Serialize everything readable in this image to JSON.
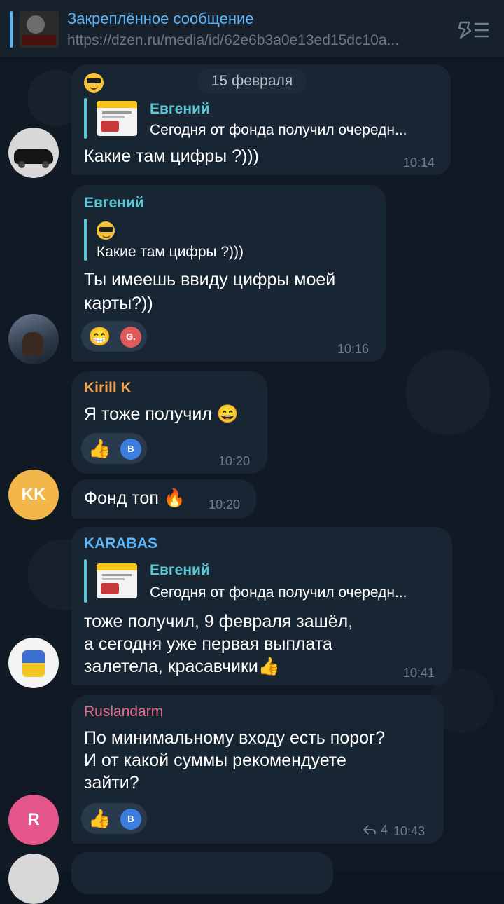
{
  "pinned": {
    "title": "Закреплённое сообщение",
    "url": "https://dzen.ru/media/id/62e6b3a0e13ed15dc10a..."
  },
  "date_divider": "15 февраля",
  "messages": [
    {
      "reply_name": "Евгений",
      "reply_text": "Сегодня от фонда получил очередн...",
      "text": "Какие там цифры ?)))",
      "time": "10:14"
    },
    {
      "sender": "Евгений",
      "reply_text": "Какие там цифры ?)))",
      "text_line1": "Ты имеешь ввиду цифры моей",
      "text_line2": "карты?))",
      "reaction_emoji": "😁",
      "reaction_user": "G.",
      "time": "10:16"
    },
    {
      "sender": "Kirill K",
      "text": "Я тоже получил 😄",
      "reaction_emoji": "👍",
      "reaction_user": "B",
      "time": "10:20"
    },
    {
      "text": "Фонд топ 🔥",
      "time": "10:20",
      "avatar_initials": "KK"
    },
    {
      "sender": "KARABAS",
      "reply_name": "Евгений",
      "reply_text": "Сегодня от фонда получил очередн...",
      "text_line1": "тоже получил, 9 февраля зашёл,",
      "text_line2": "а сегодня уже первая выплата",
      "text_line3": "залетела, красавчики👍",
      "time": "10:41"
    },
    {
      "sender": "Ruslandarm",
      "text_line1": "По минимальному входу есть порог?",
      "text_line2": "И от какой суммы рекомендуете",
      "text_line3": "зайти?",
      "reaction_emoji": "👍",
      "reaction_user": "B",
      "replies_count": "4",
      "time": "10:43",
      "avatar_initials": "R"
    }
  ],
  "colors": {
    "accent": "#5eb5f7",
    "bubble": "#182533",
    "kirill_name": "#f0a44f",
    "karabas_name": "#5eb5f7",
    "ruslan_name": "#e56a8a",
    "evgeniy_name": "#5bc8d8",
    "kk_avatar": "#f2b64a",
    "r_avatar": "#e5568a"
  }
}
